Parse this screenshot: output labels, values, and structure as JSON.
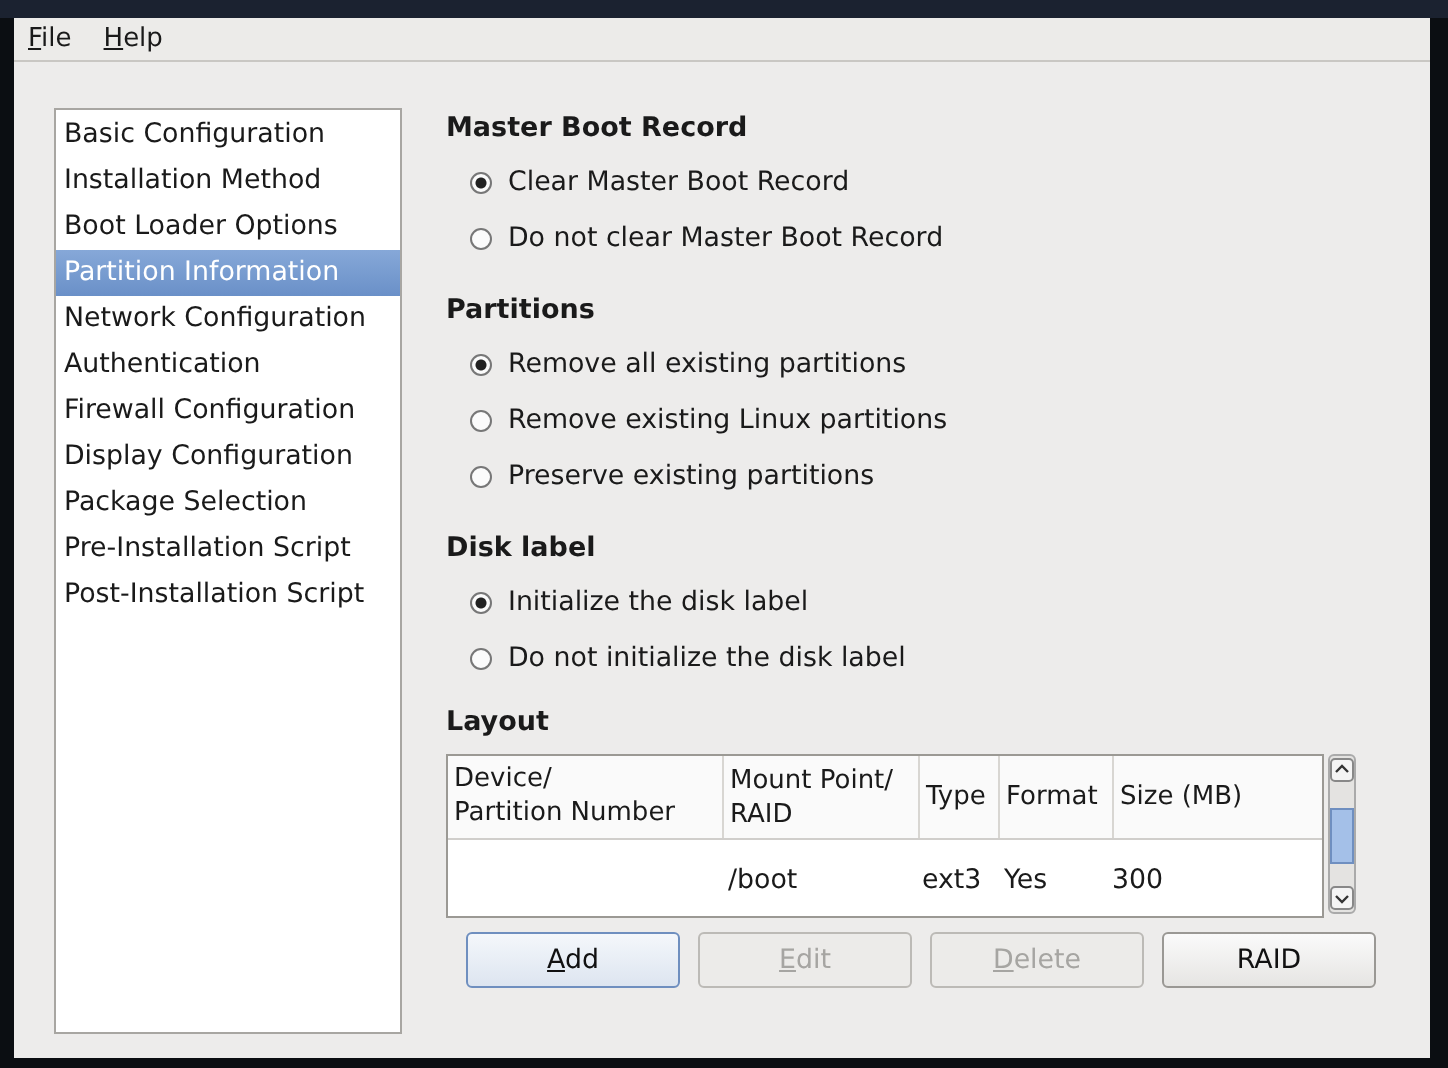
{
  "menu": [
    {
      "label": "File"
    },
    {
      "label": "Help"
    }
  ],
  "sidebar": {
    "items": [
      {
        "label": "Basic Configuration",
        "selected": false
      },
      {
        "label": "Installation Method",
        "selected": false
      },
      {
        "label": "Boot Loader Options",
        "selected": false
      },
      {
        "label": "Partition Information",
        "selected": true
      },
      {
        "label": "Network Configuration",
        "selected": false
      },
      {
        "label": "Authentication",
        "selected": false
      },
      {
        "label": "Firewall Configuration",
        "selected": false
      },
      {
        "label": "Display Configuration",
        "selected": false
      },
      {
        "label": "Package Selection",
        "selected": false
      },
      {
        "label": "Pre-Installation Script",
        "selected": false
      },
      {
        "label": "Post-Installation Script",
        "selected": false
      }
    ]
  },
  "groups": [
    {
      "title": "Master Boot Record",
      "options": [
        {
          "label": "Clear Master Boot Record",
          "selected": true
        },
        {
          "label": "Do not clear Master Boot Record",
          "selected": false
        }
      ]
    },
    {
      "title": "Partitions",
      "options": [
        {
          "label": "Remove all existing partitions",
          "selected": true
        },
        {
          "label": "Remove existing Linux partitions",
          "selected": false
        },
        {
          "label": "Preserve existing partitions",
          "selected": false
        }
      ]
    },
    {
      "title": "Disk label",
      "options": [
        {
          "label": "Initialize the disk label",
          "selected": true
        },
        {
          "label": "Do not initialize the disk label",
          "selected": false
        }
      ]
    }
  ],
  "layout": {
    "title": "Layout",
    "table": {
      "columns": [
        "Device/\nPartition Number",
        "Mount Point/\nRAID",
        "Type",
        "Format",
        "Size (MB)"
      ],
      "rows": [
        [
          "",
          "/boot",
          "ext3",
          "Yes",
          "300"
        ]
      ]
    },
    "buttons": [
      {
        "label": "Add",
        "disabled": false,
        "focused": true
      },
      {
        "label": "Edit",
        "disabled": true,
        "focused": false
      },
      {
        "label": "Delete",
        "disabled": true,
        "focused": false
      },
      {
        "label": "RAID",
        "disabled": false,
        "focused": false
      }
    ]
  }
}
